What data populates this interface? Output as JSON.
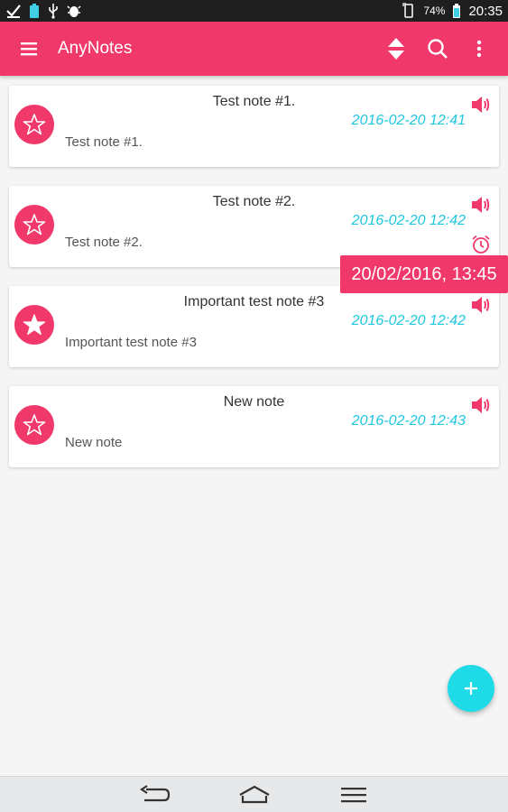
{
  "status_bar": {
    "battery_percent": "74%",
    "time": "20:35"
  },
  "app_bar": {
    "title": "AnyNotes",
    "menu_icon": "hamburger-menu-icon",
    "sort_icon": "sort-icon",
    "search_icon": "search-icon",
    "overflow_icon": "more-vert-icon"
  },
  "notes": [
    {
      "title": "Test note #1.",
      "date": "2016-02-20 12:41",
      "body": "Test note #1.",
      "starred": false,
      "has_alarm": false
    },
    {
      "title": "Test note #2.",
      "date": "2016-02-20 12:42",
      "body": "Test note #2.",
      "starred": false,
      "has_alarm": true
    },
    {
      "title": "Important test note #3",
      "date": "2016-02-20 12:42",
      "body": "Important test note #3",
      "starred": true,
      "has_alarm": false
    },
    {
      "title": "New note",
      "date": "2016-02-20 12:43",
      "body": "New note",
      "starred": false,
      "has_alarm": false
    }
  ],
  "reminder_tooltip": "20/02/2016, 13:45",
  "fab": {
    "icon": "plus-icon"
  },
  "colors": {
    "accent": "#f0386b",
    "date": "#1fc7e0",
    "fab": "#1fdbe8"
  }
}
